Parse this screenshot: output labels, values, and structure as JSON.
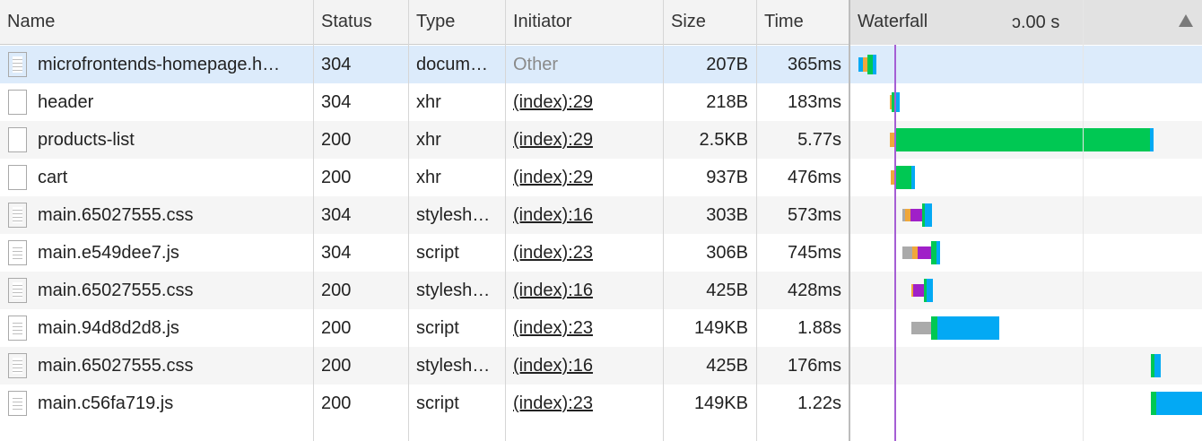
{
  "columns": {
    "name": "Name",
    "status": "Status",
    "type": "Type",
    "initiator": "Initiator",
    "size": "Size",
    "time": "Time",
    "waterfall": "Waterfall",
    "waterfall_zoom": "ɔ.00 s"
  },
  "icons": {
    "sort": "triangle-up-icon",
    "document": "document-file-icon",
    "blank": "blank-file-icon"
  },
  "colors": {
    "queueing": "#aaaaaa",
    "stalled": "#f0a73b",
    "dns": "#16a8a3",
    "ssl": "#a020c8",
    "waiting": "#00c853",
    "download": "#03a9f4",
    "dom_content_loaded": "#a55fd4"
  },
  "rows": [
    {
      "name": "microfrontends-homepage.h…",
      "status": "304",
      "type": "docum…",
      "initiator": "Other",
      "size": "207B",
      "time": "365ms",
      "icon": "document-file-icon"
    },
    {
      "name": "header",
      "status": "304",
      "type": "xhr",
      "initiator": "(index):29",
      "size": "218B",
      "time": "183ms",
      "icon": "blank-file-icon"
    },
    {
      "name": "products-list",
      "status": "200",
      "type": "xhr",
      "initiator": "(index):29",
      "size": "2.5KB",
      "time": "5.77s",
      "icon": "blank-file-icon"
    },
    {
      "name": "cart",
      "status": "200",
      "type": "xhr",
      "initiator": "(index):29",
      "size": "937B",
      "time": "476ms",
      "icon": "blank-file-icon"
    },
    {
      "name": "main.65027555.css",
      "status": "304",
      "type": "stylesh…",
      "initiator": "(index):16",
      "size": "303B",
      "time": "573ms",
      "icon": "document-file-icon"
    },
    {
      "name": "main.e549dee7.js",
      "status": "304",
      "type": "script",
      "initiator": "(index):23",
      "size": "306B",
      "time": "745ms",
      "icon": "document-file-icon"
    },
    {
      "name": "main.65027555.css",
      "status": "200",
      "type": "stylesh…",
      "initiator": "(index):16",
      "size": "425B",
      "time": "428ms",
      "icon": "document-file-icon"
    },
    {
      "name": "main.94d8d2d8.js",
      "status": "200",
      "type": "script",
      "initiator": "(index):23",
      "size": "149KB",
      "time": "1.88s",
      "icon": "document-file-icon"
    },
    {
      "name": "main.65027555.css",
      "status": "200",
      "type": "stylesh…",
      "initiator": "(index):16",
      "size": "425B",
      "time": "176ms",
      "icon": "document-file-icon"
    },
    {
      "name": "main.c56fa719.js",
      "status": "200",
      "type": "script",
      "initiator": "(index):23",
      "size": "149KB",
      "time": "1.22s",
      "icon": "document-file-icon"
    }
  ]
}
